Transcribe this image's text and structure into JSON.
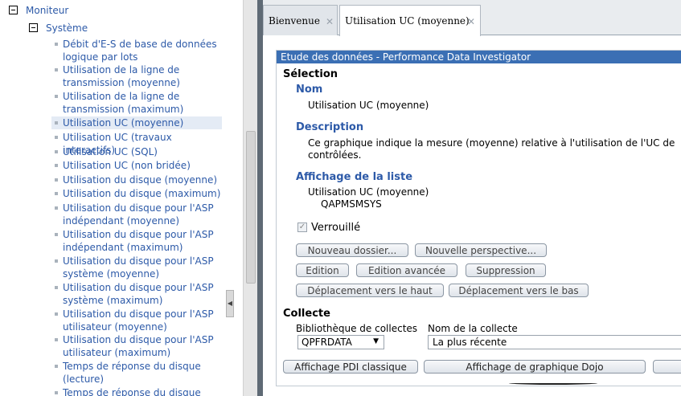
{
  "tree": {
    "root_label": "Moniteur",
    "group_label": "Système",
    "items": [
      {
        "label": "Débit d'E-S de base de données logique par lots"
      },
      {
        "label": "Utilisation de la ligne de transmission (moyenne)"
      },
      {
        "label": "Utilisation de la ligne de transmission (maximum)"
      },
      {
        "label": "Utilisation UC (moyenne)"
      },
      {
        "label": "Utilisation UC (travaux interactifs)"
      },
      {
        "label": "Utilisation UC (SQL)"
      },
      {
        "label": "Utilisation UC (non bridée)"
      },
      {
        "label": "Utilisation du disque (moyenne)"
      },
      {
        "label": "Utilisation du disque (maximum)"
      },
      {
        "label": "Utilisation du disque pour l'ASP indépendant (moyenne)"
      },
      {
        "label": "Utilisation du disque pour l'ASP indépendant (maximum)"
      },
      {
        "label": "Utilisation du disque pour l'ASP système (moyenne)"
      },
      {
        "label": "Utilisation du disque pour l'ASP système (maximum)"
      },
      {
        "label": "Utilisation du disque pour l'ASP utilisateur (moyenne)"
      },
      {
        "label": "Utilisation du disque pour l'ASP utilisateur (maximum)"
      },
      {
        "label": "Temps de réponse du disque (lecture)"
      },
      {
        "label": "Temps de réponse du disque"
      }
    ]
  },
  "tabs": [
    {
      "label": "Bienvenue"
    },
    {
      "label": "Utilisation UC (moyenne)"
    }
  ],
  "panel": {
    "title": "Etude des données - Performance Data Investigator",
    "selection": {
      "heading": "Sélection",
      "nom_label": "Nom",
      "nom_value": "Utilisation UC (moyenne)",
      "description_label": "Description",
      "description_line1": "Ce graphique indique la mesure (moyenne) relative à l'utilisation de l'UC de",
      "description_line2": "contrôlées.",
      "affichage_label": "Affichage de la liste",
      "affichage_value1": "Utilisation UC (moyenne)",
      "affichage_value2": "QAPMSMSYS",
      "verrouille_label": "Verrouillé"
    },
    "buttons": {
      "nouveau_dossier": "Nouveau dossier...",
      "nouvelle_perspective": "Nouvelle perspective...",
      "edition": "Edition",
      "edition_avancee": "Edition avancée",
      "suppression": "Suppression",
      "deplacement_haut": "Déplacement vers le haut",
      "deplacement_bas": "Déplacement vers le bas",
      "affichage_pdi": "Affichage PDI classique",
      "affichage_dojo": "Affichage de graphique Dojo"
    },
    "collecte": {
      "heading": "Collecte",
      "lib_label": "Bibliothèque de collectes",
      "name_label": "Nom de la collecte",
      "lib_value": "QPFRDATA",
      "name_value": "La plus récente"
    }
  },
  "colors": {
    "title_bar": "#3b6fb4",
    "link_blue": "#2d5aa8",
    "splitter": "#5f6a75"
  }
}
